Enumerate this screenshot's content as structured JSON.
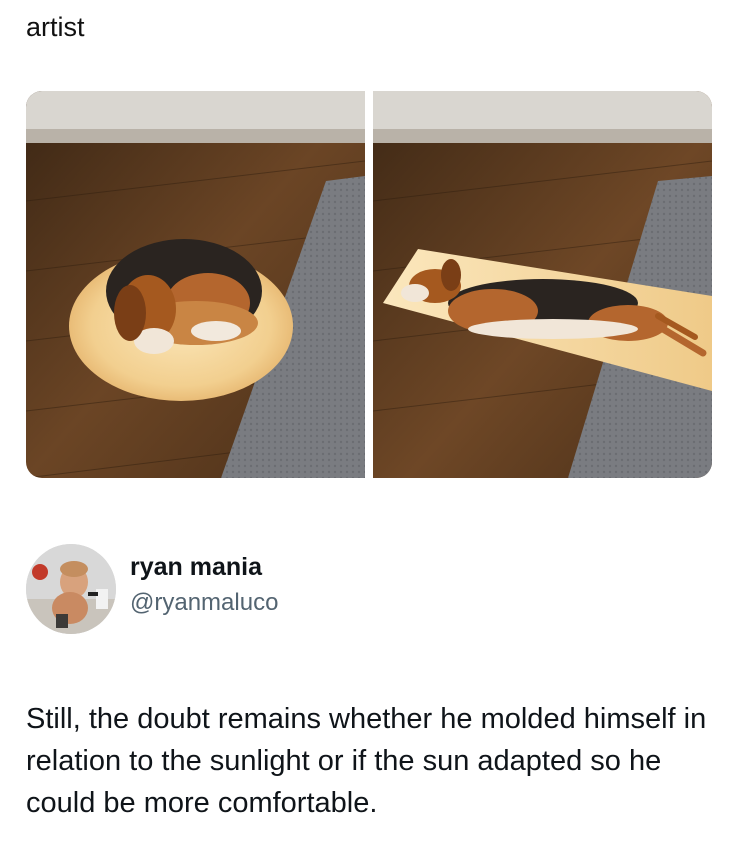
{
  "post": {
    "caption": "artist",
    "images": [
      {
        "name": "beagle curled in circle of sunlight",
        "icon": "photo-dog-curled"
      },
      {
        "name": "beagle stretched in rectangle of sunlight",
        "icon": "photo-dog-stretched"
      }
    ]
  },
  "author": {
    "display_name": "ryan mania",
    "handle": "@ryanmaluco",
    "avatar_icon": "avatar-photo"
  },
  "tweet": {
    "text": "Still, the doubt remains whether he molded himself in relation to the sunlight or if the sun adapted so he could be more comfortable."
  },
  "colors": {
    "floor": "#5a3a1f",
    "sunlight": "#f6d9a0",
    "rug": "#7d7f84",
    "handle_gray": "#536471"
  }
}
